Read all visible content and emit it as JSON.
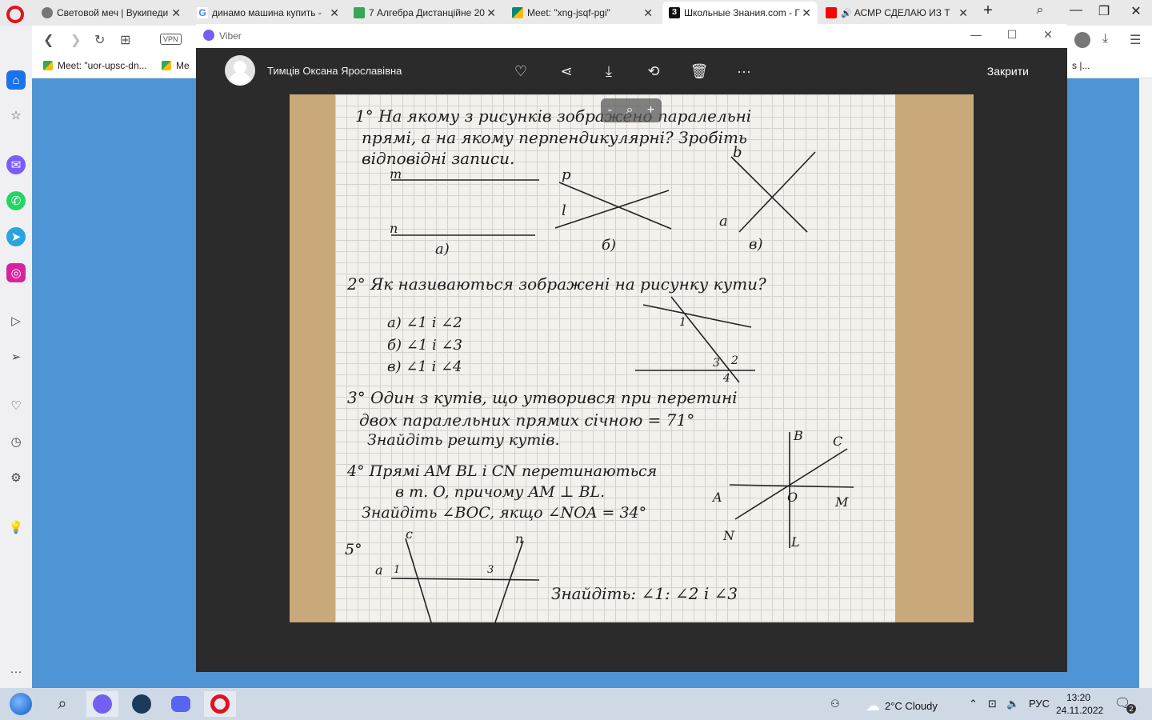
{
  "browser": {
    "tabs": [
      {
        "label": "Световой меч | Вукипеди",
        "color": "#777777"
      },
      {
        "label": "динамо машина купить -",
        "color": "#4285f4"
      },
      {
        "label": "7 Алгебра Дистанційне 20",
        "color": "#34a853"
      },
      {
        "label": "Meet: \"xng-jsqf-pgi\"",
        "color": "#00897b"
      },
      {
        "label": "Школьные Знания.com - Г",
        "color": "#111111"
      },
      {
        "label": "АСМР СДЕЛАЮ ИЗ ТЕ",
        "color": "#ff0000"
      }
    ],
    "bookmarks": [
      {
        "label": "Meet: \"uor-upsc-dn..."
      },
      {
        "label": "Me"
      }
    ],
    "bookmark_right_label": "s |...",
    "vpn_label": "VPN"
  },
  "viber": {
    "window_title": "Viber",
    "contact_name": "Тимців Оксана Ярославівна",
    "close_label": "Закрити",
    "zoom": {
      "minus": "-",
      "plus": "+"
    }
  },
  "handwritten": {
    "q1_line1": "1° На якому з рисунків зображено паралельні",
    "q1_line2": "прямі, а на якому перпендикулярні? Зробіть",
    "q1_line3": "відповідні записи.",
    "fig_a": "а)",
    "fig_b": "б)",
    "fig_c": "в)",
    "m": "m",
    "n": "n",
    "p": "p",
    "l": "l",
    "b": "b",
    "a": "a",
    "q2": "2° Як називаються зображені на рисунку кути?",
    "q2_a": "а) ∠1 і ∠2",
    "q2_b": "б) ∠1 і ∠3",
    "q2_c": "в) ∠1 і ∠4",
    "n1": "1",
    "n2": "2",
    "n3": "3",
    "n4": "4",
    "q3_line1": "3° Один з кутів, що утворився при перетині",
    "q3_line2": "двох паралельних прямих січною = 71°",
    "q3_line3": "Знайдіть решту кутів.",
    "q4_line1": "4° Прямі AM BL і CN перетинаються",
    "q4_line2": "в т. O, причому AM ⊥ BL.",
    "q4_line3": "Знайдіть ∠BOC, якщо ∠NOA = 34°",
    "B": "B",
    "C": "C",
    "A": "A",
    "O": "O",
    "M": "M",
    "N": "N",
    "L": "L",
    "q5": "5°",
    "q5_c": "c",
    "q5_n": "n",
    "q5_a": "a",
    "q5_1": "1",
    "q5_3": "3",
    "q5_task": "Знайдіть: ∠1: ∠2 і ∠3"
  },
  "taskbar": {
    "weather": "2°C  Cloudy",
    "lang": "РУС",
    "time": "13:20",
    "date": "24.11.2022",
    "notifications": "2"
  }
}
